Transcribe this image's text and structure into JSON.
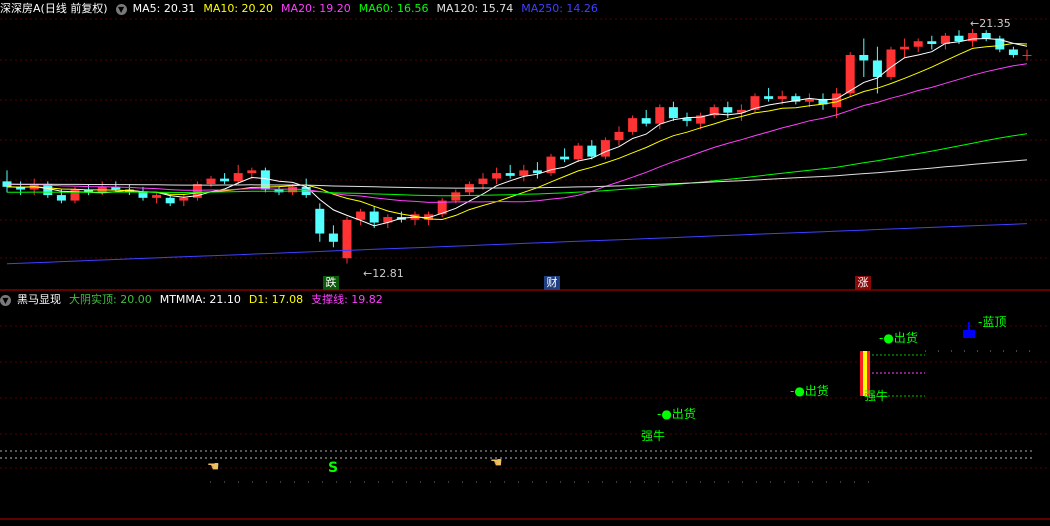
{
  "main_panel": {
    "title": "深深房A(日线 前复权)",
    "chevron": "chevron-down-icon",
    "indicators": [
      {
        "label": "MA5: 20.31",
        "color": "#ffffff"
      },
      {
        "label": "MA10: 20.20",
        "color": "#ffff00"
      },
      {
        "label": "MA20: 19.20",
        "color": "#ff40ff"
      },
      {
        "label": "MA60: 16.56",
        "color": "#00ff00"
      },
      {
        "label": "MA120: 15.74",
        "color": "#e0e0e0"
      },
      {
        "label": "MA250: 14.26",
        "color": "#4040ff"
      }
    ],
    "high_label": "21.35",
    "low_label": "12.81",
    "markers": [
      {
        "text": "跌",
        "bg": "#0a5a0a",
        "color": "#ffffff"
      },
      {
        "text": "财",
        "bg": "#1f3f7f",
        "color": "#ffffff"
      },
      {
        "text": "涨",
        "bg": "#8a0a0a",
        "color": "#ffffff"
      }
    ]
  },
  "sub_panel": {
    "title": "黑马显现",
    "chevron": "chevron-down-icon",
    "indicators": [
      {
        "label": "大阴实顶: 20.00",
        "color": "#40c040"
      },
      {
        "label": "MTMMA: 21.10",
        "color": "#ffffff"
      },
      {
        "label": "D1: 17.08",
        "color": "#ffff00"
      },
      {
        "label": "支撑线: 19.82",
        "color": "#ff40ff"
      }
    ],
    "signals": [
      {
        "text": "-●出货",
        "color": "#00ff00"
      },
      {
        "text": "强牛",
        "color": "#00ff00"
      },
      {
        "text": "-●出货",
        "color": "#00ff00"
      },
      {
        "text": "-●出货",
        "color": "#00ff00"
      },
      {
        "text": "强牛",
        "color": "#00ff00"
      },
      {
        "text": "蓝顶",
        "color": "#00ff00"
      },
      {
        "text": "S",
        "color": "#00ff00"
      }
    ]
  },
  "colors": {
    "up": "#ff3333",
    "down": "#54ffff",
    "grid": "#5a0000",
    "separator": "#c00000"
  },
  "chart_data": {
    "type": "candlestick",
    "candles": [
      [
        15.8,
        16.2,
        15.4,
        15.6
      ],
      [
        15.6,
        15.8,
        15.3,
        15.5
      ],
      [
        15.5,
        15.9,
        15.3,
        15.7
      ],
      [
        15.7,
        15.8,
        15.2,
        15.3
      ],
      [
        15.3,
        15.5,
        15.0,
        15.1
      ],
      [
        15.1,
        15.6,
        15.0,
        15.5
      ],
      [
        15.5,
        15.7,
        15.3,
        15.4
      ],
      [
        15.4,
        15.8,
        15.3,
        15.6
      ],
      [
        15.6,
        15.8,
        15.4,
        15.5
      ],
      [
        15.5,
        15.7,
        15.3,
        15.4
      ],
      [
        15.4,
        15.6,
        15.1,
        15.2
      ],
      [
        15.2,
        15.4,
        15.0,
        15.3
      ],
      [
        15.2,
        15.3,
        14.9,
        15.0
      ],
      [
        15.1,
        15.3,
        14.9,
        15.2
      ],
      [
        15.2,
        15.8,
        15.1,
        15.7
      ],
      [
        15.7,
        16.0,
        15.6,
        15.9
      ],
      [
        15.9,
        16.1,
        15.7,
        15.8
      ],
      [
        15.8,
        16.4,
        15.7,
        16.1
      ],
      [
        16.1,
        16.3,
        15.9,
        16.2
      ],
      [
        16.2,
        16.3,
        15.4,
        15.5
      ],
      [
        15.5,
        15.6,
        15.3,
        15.4
      ],
      [
        15.4,
        15.7,
        15.3,
        15.6
      ],
      [
        15.6,
        15.9,
        15.2,
        15.3
      ],
      [
        14.8,
        15.0,
        13.6,
        13.9
      ],
      [
        13.9,
        14.2,
        13.4,
        13.6
      ],
      [
        13.0,
        14.5,
        12.81,
        14.4
      ],
      [
        14.4,
        14.8,
        14.2,
        14.7
      ],
      [
        14.7,
        14.9,
        14.1,
        14.3
      ],
      [
        14.3,
        14.6,
        14.1,
        14.5
      ],
      [
        14.5,
        14.7,
        14.3,
        14.4
      ],
      [
        14.4,
        14.7,
        14.2,
        14.6
      ],
      [
        14.4,
        14.7,
        14.2,
        14.6
      ],
      [
        14.6,
        15.2,
        14.5,
        15.1
      ],
      [
        15.1,
        15.5,
        15.0,
        15.4
      ],
      [
        15.4,
        15.8,
        15.3,
        15.7
      ],
      [
        15.7,
        16.1,
        15.5,
        15.9
      ],
      [
        15.9,
        16.3,
        15.7,
        16.1
      ],
      [
        16.1,
        16.4,
        15.9,
        16.0
      ],
      [
        16.0,
        16.4,
        15.8,
        16.2
      ],
      [
        16.2,
        16.5,
        15.9,
        16.1
      ],
      [
        16.1,
        16.8,
        16.0,
        16.7
      ],
      [
        16.7,
        17.0,
        16.5,
        16.6
      ],
      [
        16.6,
        17.2,
        16.5,
        17.1
      ],
      [
        17.1,
        17.3,
        16.6,
        16.7
      ],
      [
        16.7,
        17.4,
        16.6,
        17.3
      ],
      [
        17.3,
        17.8,
        17.1,
        17.6
      ],
      [
        17.6,
        18.2,
        17.5,
        18.1
      ],
      [
        18.1,
        18.4,
        17.8,
        17.9
      ],
      [
        17.9,
        18.6,
        17.7,
        18.5
      ],
      [
        18.5,
        18.7,
        18.0,
        18.1
      ],
      [
        18.1,
        18.3,
        17.8,
        18.0
      ],
      [
        17.9,
        18.3,
        17.7,
        18.2
      ],
      [
        18.2,
        18.6,
        18.1,
        18.5
      ],
      [
        18.5,
        18.7,
        18.1,
        18.3
      ],
      [
        18.3,
        18.6,
        18.0,
        18.4
      ],
      [
        18.4,
        19.0,
        18.3,
        18.9
      ],
      [
        18.9,
        19.2,
        18.7,
        18.8
      ],
      [
        18.8,
        19.1,
        18.6,
        18.9
      ],
      [
        18.9,
        19.0,
        18.6,
        18.7
      ],
      [
        18.7,
        19.0,
        18.5,
        18.8
      ],
      [
        18.8,
        19.0,
        18.4,
        18.6
      ],
      [
        18.5,
        19.2,
        18.1,
        19.0
      ],
      [
        19.0,
        20.5,
        18.9,
        20.4
      ],
      [
        20.4,
        21.0,
        19.6,
        20.2
      ],
      [
        20.2,
        20.7,
        19.0,
        19.6
      ],
      [
        19.6,
        20.7,
        19.5,
        20.6
      ],
      [
        20.6,
        21.0,
        20.3,
        20.7
      ],
      [
        20.7,
        21.0,
        20.5,
        20.9
      ],
      [
        20.9,
        21.1,
        20.6,
        20.8
      ],
      [
        20.8,
        21.2,
        20.6,
        21.1
      ],
      [
        21.1,
        21.3,
        20.8,
        20.9
      ],
      [
        20.9,
        21.35,
        20.7,
        21.2
      ],
      [
        21.2,
        21.3,
        20.9,
        21.0
      ],
      [
        21.0,
        21.1,
        20.5,
        20.6
      ],
      [
        20.6,
        20.7,
        20.3,
        20.4
      ],
      [
        20.4,
        20.6,
        20.2,
        20.4
      ]
    ]
  }
}
